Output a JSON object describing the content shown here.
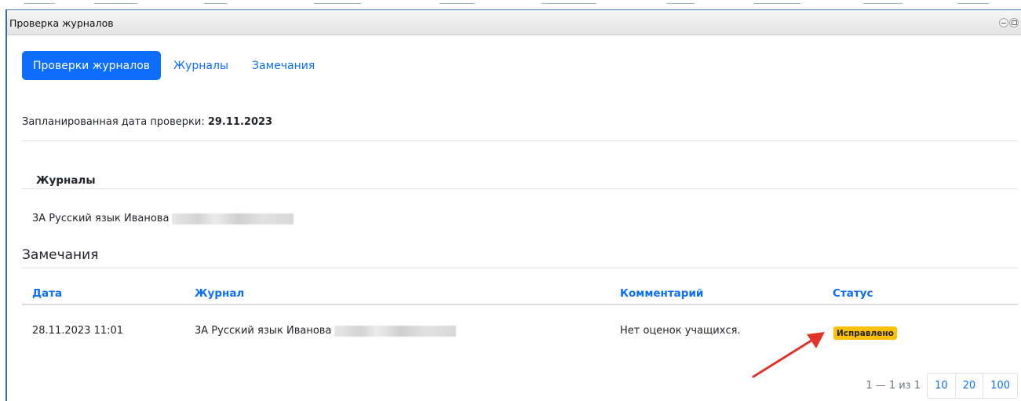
{
  "window": {
    "title": "Проверка журналов"
  },
  "tabs": [
    {
      "label": "Проверки журналов",
      "active": true
    },
    {
      "label": "Журналы",
      "active": false
    },
    {
      "label": "Замечания",
      "active": false
    }
  ],
  "planned": {
    "label": "Запланированная дата проверки: ",
    "date": "29.11.2023"
  },
  "journals": {
    "heading": "Журналы",
    "items": [
      {
        "name": "3А Русский язык Иванова"
      }
    ]
  },
  "remarks": {
    "title": "Замечания",
    "columns": [
      "Дата",
      "Журнал",
      "Комментарий",
      "Статус"
    ],
    "rows": [
      {
        "date": "28.11.2023 11:01",
        "journal": "3А Русский язык Иванова",
        "comment": "Нет оценок учащихся.",
        "status": "Исправлено"
      }
    ]
  },
  "pagination": {
    "info": "1 — 1 из 1",
    "page_sizes": [
      "10",
      "20",
      "100"
    ]
  },
  "colors": {
    "accent": "#0d6efd",
    "status_badge": "#ffc107",
    "arrow": "#e0342b"
  }
}
